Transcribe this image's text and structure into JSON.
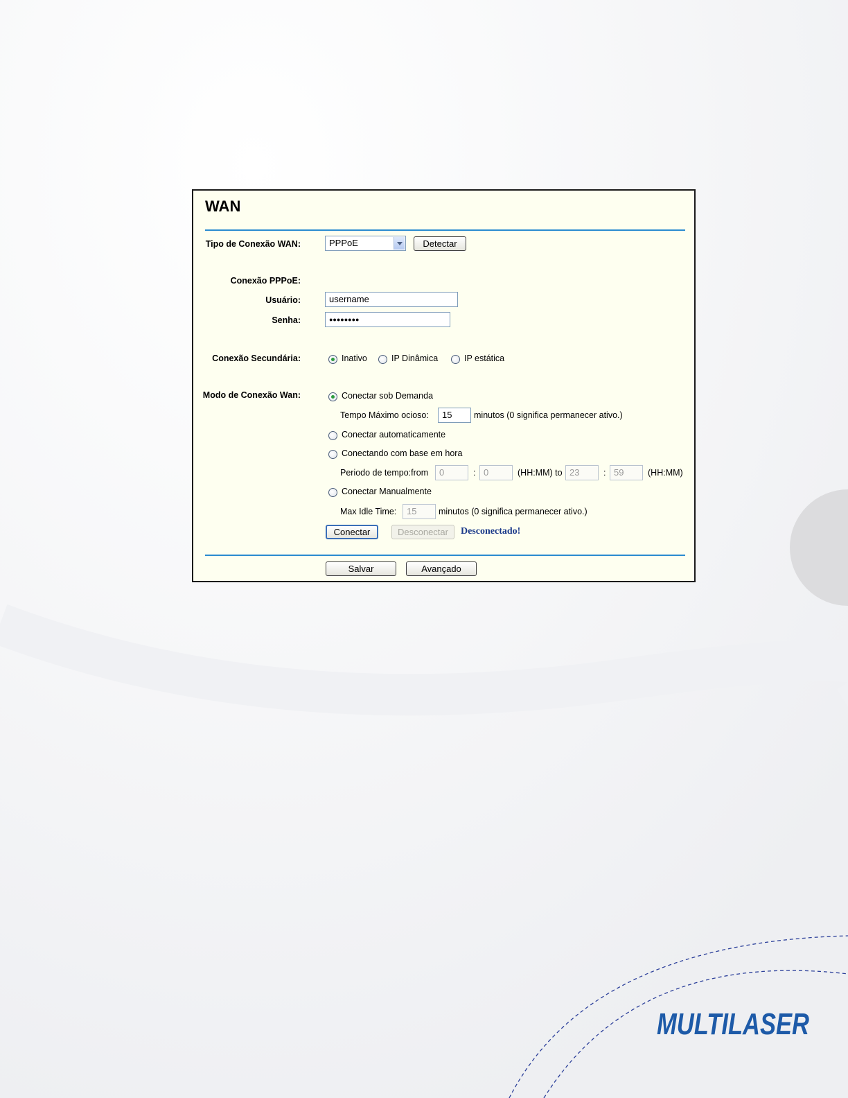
{
  "page": {
    "title": "WAN"
  },
  "wan_type": {
    "label": "Tipo de Conexão WAN:",
    "value": "PPPoE",
    "detect_label": "Detectar"
  },
  "pppoe": {
    "section_label": "Conexão PPPoE:",
    "user_label": "Usuário:",
    "user_value": "username",
    "password_label": "Senha:",
    "password_value": "●●●●●●●●"
  },
  "secondary": {
    "label": "Conexão Secundária:",
    "options": [
      "Inativo",
      "IP Dinâmica",
      "IP estática"
    ],
    "selected": "Inativo"
  },
  "mode": {
    "label": "Modo de Conexão Wan:",
    "on_demand_label": "Conectar sob Demanda",
    "idle_label": "Tempo Máximo ocioso:",
    "idle_value": "15",
    "idle_suffix": "minutos (0 significa permanecer ativo.)",
    "auto_label": "Conectar automaticamente",
    "time_based_label": "Conectando com base em hora",
    "period_label": "Periodo de tempo:from",
    "from_h": "0",
    "from_m": "0",
    "hhmm_to": "(HH:MM) to",
    "to_h": "23",
    "to_m": "59",
    "hhmm": "(HH:MM)",
    "colon": ":",
    "manual_label": "Conectar Manualmente",
    "max_idle_label": "Max Idle Time:",
    "max_idle_value": "15",
    "max_idle_suffix": "minutos (0 significa permanecer ativo.)",
    "selected": "Conectar sob Demanda"
  },
  "actions": {
    "connect_label": "Conectar",
    "disconnect_label": "Desconectar",
    "status_text": "Desconectado!",
    "save_label": "Salvar",
    "advanced_label": "Avançado"
  },
  "colors": {
    "rule": "#2a8bd0",
    "panel_bg": "#fefff0",
    "status": "#1b3a8a",
    "brand": "#1d5aa8"
  },
  "brand": {
    "logo_text": "MULTILASER"
  }
}
